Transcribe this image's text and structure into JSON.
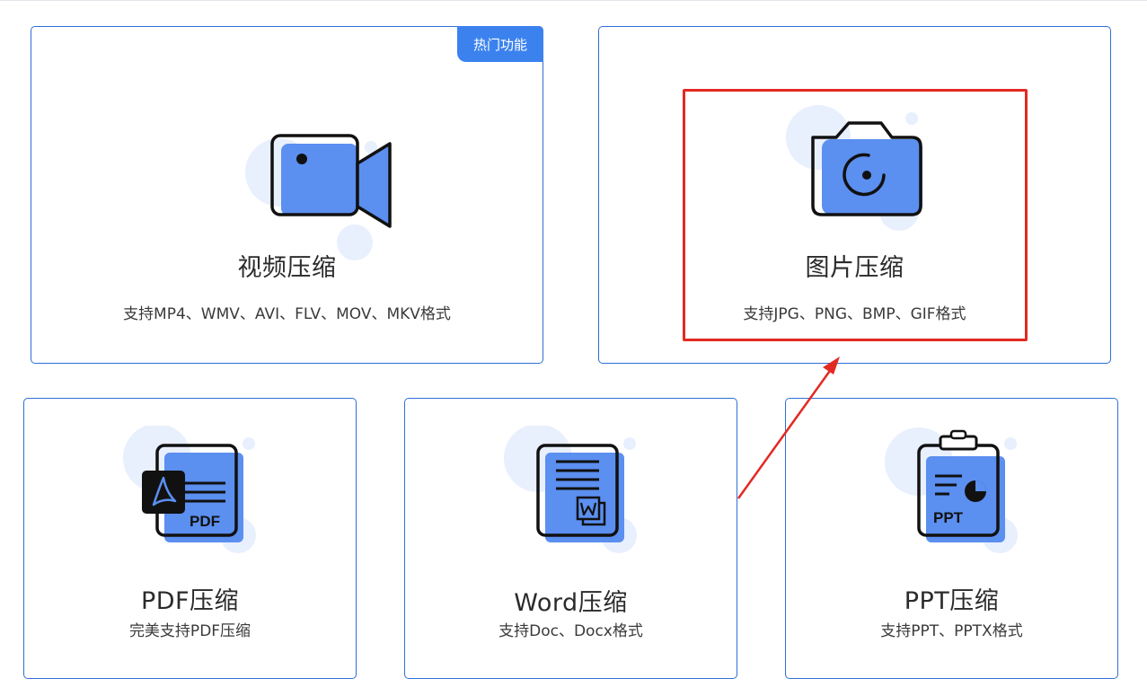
{
  "colors": {
    "accent": "#3c82ee",
    "card_border": "#2f6fd6",
    "icon_fill": "#5b8ff0",
    "icon_bubble": "#e8effd",
    "annotation": "#e22a22"
  },
  "cards": {
    "video": {
      "title": "视频压缩",
      "desc": "支持MP4、WMV、AVI、FLV、MOV、MKV格式",
      "badge": "热门功能",
      "icon": "video-camera-icon"
    },
    "image": {
      "title": "图片压缩",
      "desc": "支持JPG、PNG、BMP、GIF格式",
      "icon": "camera-icon"
    },
    "pdf": {
      "title": "PDF压缩",
      "desc": "完美支持PDF压缩",
      "icon": "pdf-document-icon",
      "icon_text": "PDF"
    },
    "word": {
      "title": "Word压缩",
      "desc": "支持Doc、Docx格式",
      "icon": "word-document-icon"
    },
    "ppt": {
      "title": "PPT压缩",
      "desc": "支持PPT、PPTX格式",
      "icon": "ppt-clipboard-icon",
      "icon_text": "PPT"
    }
  },
  "annotation": {
    "type": "red-highlight-box-with-arrow",
    "target": "image"
  }
}
